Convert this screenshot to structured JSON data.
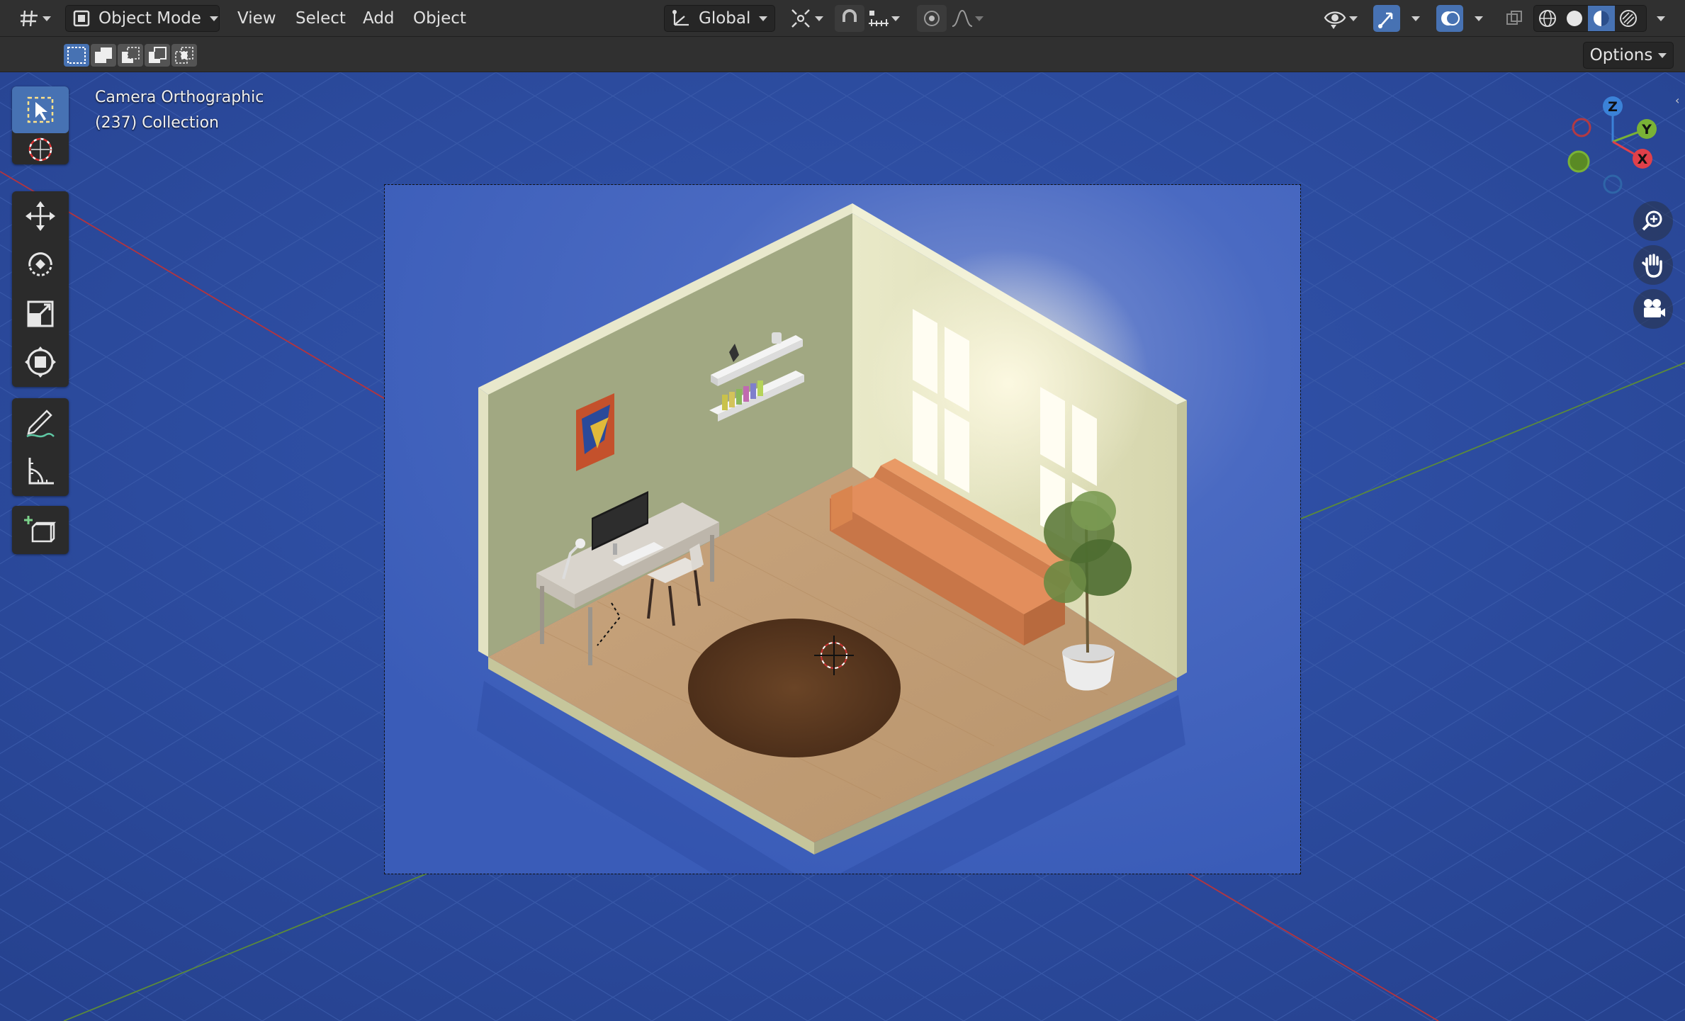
{
  "header": {
    "editor_type_icon": "grid-editor-icon",
    "mode": "Object Mode",
    "menus": [
      "View",
      "Select",
      "Add",
      "Object"
    ],
    "transform_orientation": "Global",
    "icons": {
      "pivot": "pivot-point-icon",
      "snap": "snap-magnet-icon",
      "snap_target": "snap-increment-icon",
      "proportional": "proportional-edit-icon",
      "falloff": "falloff-curve-icon",
      "visibility": "eye-visibility-icon",
      "gizmo": "gizmo-toggle-icon",
      "overlays": "overlays-icon",
      "xray": "xray-icon",
      "shading_wire": "wireframe-shading-icon",
      "shading_solid": "solid-shading-icon",
      "shading_material": "material-shading-icon",
      "shading_rendered": "rendered-shading-icon"
    }
  },
  "subheader": {
    "options_label": "Options"
  },
  "viewport": {
    "view_name": "Camera Orthographic",
    "collection_info": "(237) Collection",
    "background_color": "#2c4a9e",
    "axis_gizmo": {
      "z": "Z",
      "y": "Y",
      "x": "X"
    }
  },
  "toolbar": {
    "tools": [
      "select-box-tool",
      "cursor-tool",
      "move-tool",
      "rotate-tool",
      "scale-tool",
      "transform-tool",
      "annotate-tool",
      "measure-tool",
      "add-cube-tool"
    ]
  },
  "nav": [
    "zoom-icon",
    "pan-hand-icon",
    "camera-view-icon"
  ]
}
